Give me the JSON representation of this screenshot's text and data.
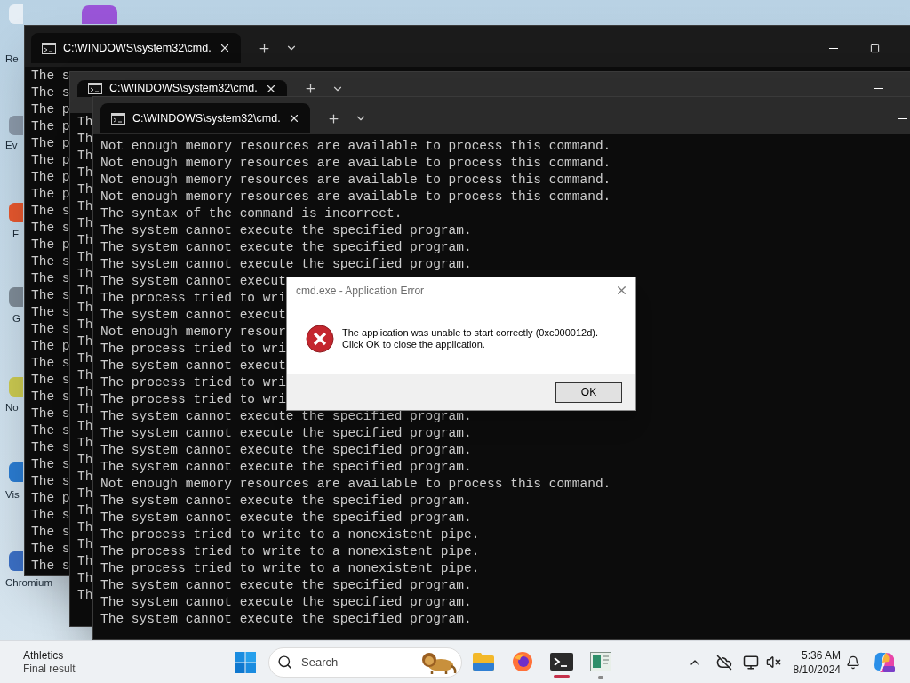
{
  "desktop_icons": [
    {
      "label": "Re"
    },
    {
      "label": "Ev"
    },
    {
      "label": "F"
    },
    {
      "label": "G"
    },
    {
      "label": "No"
    },
    {
      "label": "Vis"
    },
    {
      "label": "Chromium"
    }
  ],
  "windows": [
    {
      "tab_title": "C:\\WINDOWS\\system32\\cmd.",
      "lines": [
        "The s",
        "The s",
        "The p",
        "The p",
        "The p",
        "The p",
        "The p",
        "The p",
        "The s",
        "The s",
        "The p",
        "The s",
        "The s",
        "The s",
        "The s",
        "The s",
        "The p",
        "The s",
        "The s",
        "The s",
        "The s",
        "The s",
        "The s",
        "The s",
        "The s",
        "The p",
        "The s",
        "The s",
        "The s",
        "The s"
      ]
    },
    {
      "tab_title": "C:\\WINDOWS\\system32\\cmd.",
      "lines": [
        "Th",
        "Th",
        "Th",
        "Th",
        "Th",
        "Th",
        "Th",
        "Th",
        "Th",
        "Th",
        "Th",
        "Th",
        "Th",
        "Th",
        "Th",
        "Th",
        "Th",
        "Th",
        "Th",
        "Th",
        "Th",
        "Th",
        "Th",
        "Th",
        "Th",
        "Th",
        "Th",
        "Th",
        "Th"
      ]
    },
    {
      "tab_title": "C:\\WINDOWS\\system32\\cmd.",
      "lines": [
        "Not enough memory resources are available to process this command.",
        "Not enough memory resources are available to process this command.",
        "Not enough memory resources are available to process this command.",
        "Not enough memory resources are available to process this command.",
        "The syntax of the command is incorrect.",
        "The system cannot execute the specified program.",
        "The system cannot execute the specified program.",
        "The system cannot execute the specified program.",
        "The system cannot execut",
        "The process tried to wri",
        "The system cannot execut",
        "Not enough memory resour",
        "The process tried to wri",
        "The system cannot execut",
        "The process tried to wri",
        "The process tried to wri",
        "The system cannot execute the specified program.",
        "The system cannot execute the specified program.",
        "The system cannot execute the specified program.",
        "The system cannot execute the specified program.",
        "Not enough memory resources are available to process this command.",
        "The system cannot execute the specified program.",
        "The system cannot execute the specified program.",
        "The process tried to write to a nonexistent pipe.",
        "The process tried to write to a nonexistent pipe.",
        "The process tried to write to a nonexistent pipe.",
        "The system cannot execute the specified program.",
        "The system cannot execute the specified program.",
        "The system cannot execute the specified program."
      ]
    }
  ],
  "dialog": {
    "title": "cmd.exe - Application Error",
    "message_lines": [
      "The application was unable to start correctly (0xc000012d).",
      "Click OK to close the application."
    ],
    "button": "OK"
  },
  "taskbar": {
    "widget": {
      "title": "Athletics",
      "subtitle": "Final result"
    },
    "search": {
      "placeholder": "Search"
    },
    "apps": [
      {
        "kind": "folder",
        "running": false,
        "selected": false
      },
      {
        "kind": "browser",
        "running": false,
        "selected": false
      },
      {
        "kind": "terminal",
        "running": true,
        "selected": true
      },
      {
        "kind": "app",
        "running": true,
        "selected": false
      }
    ],
    "clock": {
      "time": "5:36 AM",
      "date": "8/10/2024"
    }
  }
}
